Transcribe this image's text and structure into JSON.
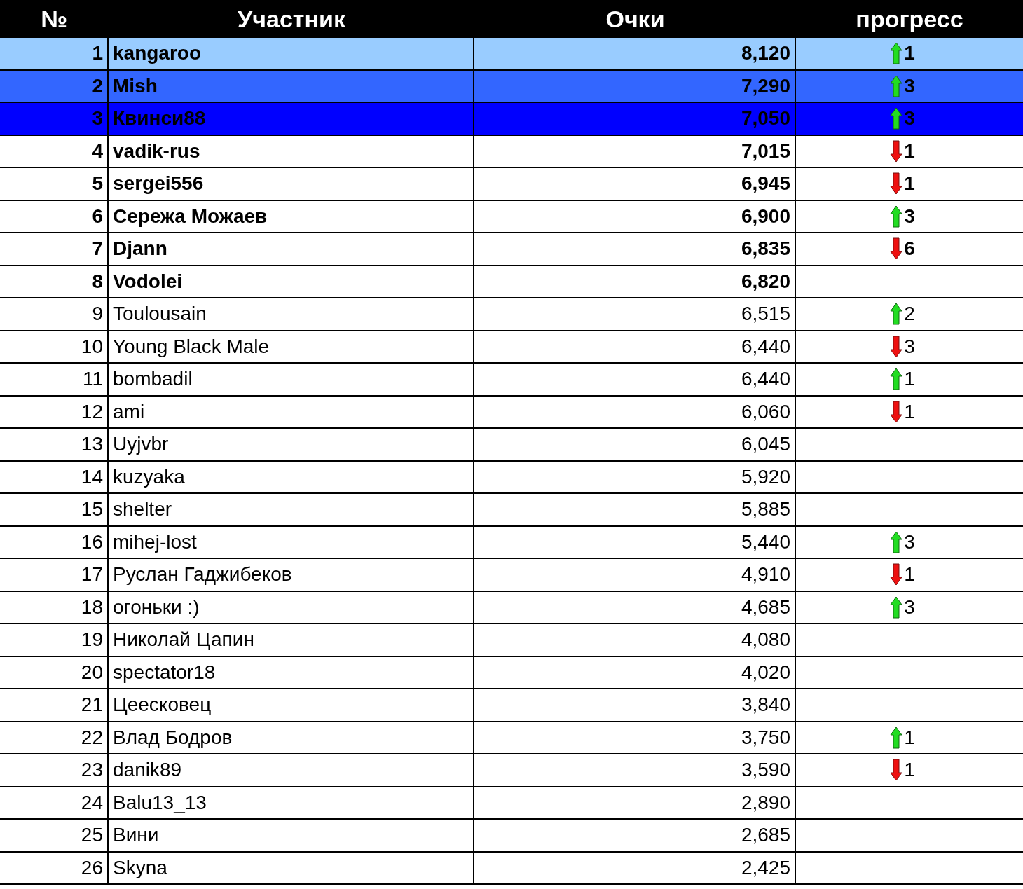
{
  "columns": [
    "№",
    "Участник",
    "Очки",
    "прогресс"
  ],
  "rows": [
    {
      "rank": "1",
      "name": "kangaroo",
      "points": "8,120",
      "kind": "up",
      "change": "1",
      "bold": true,
      "color": "#99ccff"
    },
    {
      "rank": "2",
      "name": "Mish",
      "points": "7,290",
      "kind": "up",
      "change": "3",
      "bold": true,
      "color": "#3366ff"
    },
    {
      "rank": "3",
      "name": "Квинси88",
      "points": "7,050",
      "kind": "up",
      "change": "3",
      "bold": true,
      "color": "#0000ff"
    },
    {
      "rank": "4",
      "name": "vadik-rus",
      "points": "7,015",
      "kind": "down",
      "change": "1",
      "bold": true
    },
    {
      "rank": "5",
      "name": "sergei556",
      "points": "6,945",
      "kind": "down",
      "change": "1",
      "bold": true
    },
    {
      "rank": "6",
      "name": "Сережа Можаев",
      "points": "6,900",
      "kind": "up",
      "change": "3",
      "bold": true
    },
    {
      "rank": "7",
      "name": "Djann",
      "points": "6,835",
      "kind": "down",
      "change": "6",
      "bold": true
    },
    {
      "rank": "8",
      "name": "Vodolei",
      "points": "6,820",
      "bold": true
    },
    {
      "rank": "9",
      "name": "Toulousain",
      "points": "6,515",
      "kind": "up",
      "change": "2",
      "bold": false
    },
    {
      "rank": "10",
      "name": "Young Black Male",
      "points": "6,440",
      "kind": "down",
      "change": "3",
      "bold": false
    },
    {
      "rank": "11",
      "name": "bombadil",
      "points": "6,440",
      "kind": "up",
      "change": "1",
      "bold": false
    },
    {
      "rank": "12",
      "name": "ami",
      "points": "6,060",
      "kind": "down",
      "change": "1",
      "bold": false
    },
    {
      "rank": "13",
      "name": "Uyjvbr",
      "points": "6,045",
      "bold": false
    },
    {
      "rank": "14",
      "name": "kuzyaka",
      "points": "5,920",
      "bold": false
    },
    {
      "rank": "15",
      "name": "shelter",
      "points": "5,885",
      "bold": false
    },
    {
      "rank": "16",
      "name": "mihej-lost",
      "points": "5,440",
      "kind": "up",
      "change": "3",
      "bold": false
    },
    {
      "rank": "17",
      "name": "Руслан Гаджибеков",
      "points": "4,910",
      "kind": "down",
      "change": "1",
      "bold": false
    },
    {
      "rank": "18",
      "name": "огоньки :)",
      "points": "4,685",
      "kind": "up",
      "change": "3",
      "bold": false
    },
    {
      "rank": "19",
      "name": "Николай Цапин",
      "points": "4,080",
      "bold": false
    },
    {
      "rank": "20",
      "name": "spectator18",
      "points": "4,020",
      "bold": false
    },
    {
      "rank": "21",
      "name": "Цеесковец",
      "points": "3,840",
      "bold": false
    },
    {
      "rank": "22",
      "name": "Влад Бодров",
      "points": "3,750",
      "kind": "up",
      "change": "1",
      "bold": false
    },
    {
      "rank": "23",
      "name": "danik89",
      "points": "3,590",
      "kind": "down",
      "change": "1",
      "bold": false
    },
    {
      "rank": "24",
      "name": "Balu13_13",
      "points": "2,890",
      "bold": false
    },
    {
      "rank": "25",
      "name": "Вини",
      "points": "2,685",
      "bold": false
    },
    {
      "rank": "26",
      "name": "Skyna",
      "points": "2,425",
      "bold": false
    }
  ]
}
